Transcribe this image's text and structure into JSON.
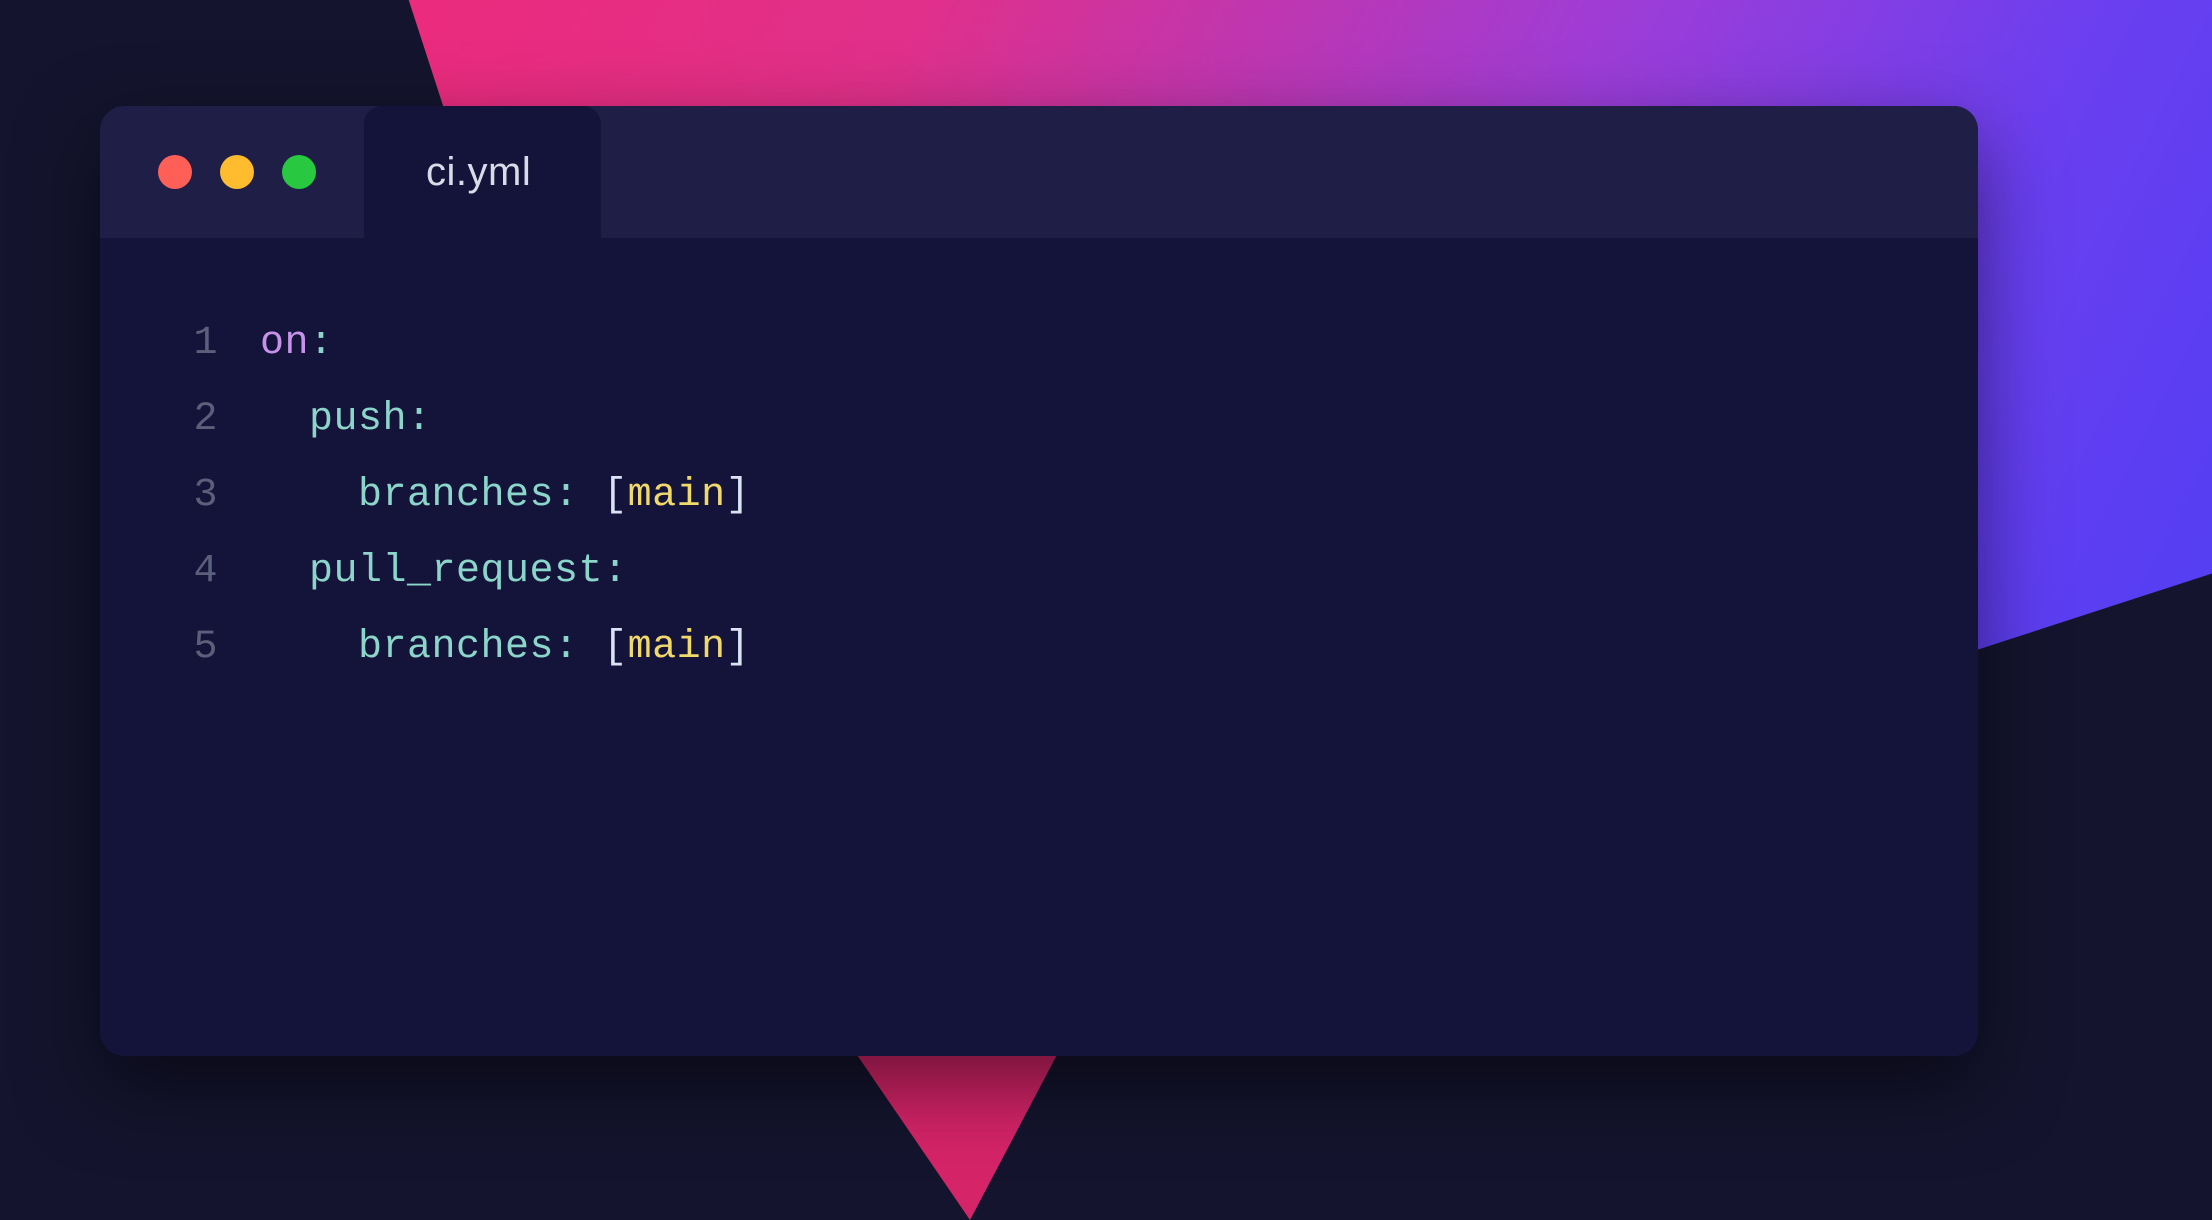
{
  "tab": {
    "filename": "ci.yml"
  },
  "code": {
    "lines": [
      {
        "num": "1",
        "tokens": [
          {
            "t": "on",
            "c": "tok-key-top"
          },
          {
            "t": ":",
            "c": "tok-punct"
          }
        ]
      },
      {
        "num": "2",
        "tokens": [
          {
            "t": "  ",
            "c": ""
          },
          {
            "t": "push",
            "c": "tok-key"
          },
          {
            "t": ":",
            "c": "tok-punct"
          }
        ]
      },
      {
        "num": "3",
        "tokens": [
          {
            "t": "    ",
            "c": ""
          },
          {
            "t": "branches",
            "c": "tok-key"
          },
          {
            "t": ":",
            "c": "tok-punct"
          },
          {
            "t": " ",
            "c": ""
          },
          {
            "t": "[",
            "c": "tok-bracket"
          },
          {
            "t": "main",
            "c": "tok-value"
          },
          {
            "t": "]",
            "c": "tok-bracket"
          }
        ]
      },
      {
        "num": "4",
        "tokens": [
          {
            "t": "  ",
            "c": ""
          },
          {
            "t": "pull_request",
            "c": "tok-key"
          },
          {
            "t": ":",
            "c": "tok-punct"
          }
        ]
      },
      {
        "num": "5",
        "tokens": [
          {
            "t": "    ",
            "c": ""
          },
          {
            "t": "branches",
            "c": "tok-key"
          },
          {
            "t": ":",
            "c": "tok-punct"
          },
          {
            "t": " ",
            "c": ""
          },
          {
            "t": "[",
            "c": "tok-bracket"
          },
          {
            "t": "main",
            "c": "tok-value"
          },
          {
            "t": "]",
            "c": "tok-bracket"
          }
        ]
      }
    ]
  }
}
